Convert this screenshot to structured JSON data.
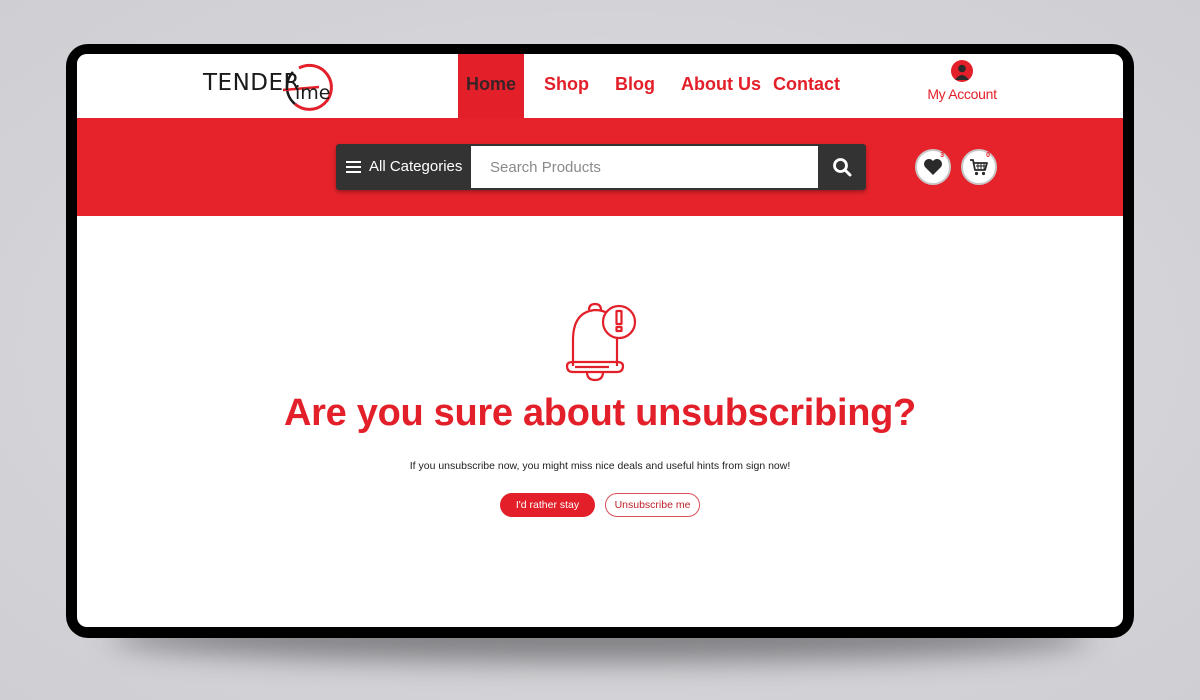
{
  "brand": {
    "logo_word1": "TENDER",
    "logo_word2": "ime",
    "accent_color": "#e3202a",
    "dark_color": "#333333"
  },
  "nav": {
    "items": [
      {
        "label": "Home",
        "active": true
      },
      {
        "label": "Shop",
        "active": false
      },
      {
        "label": "Blog",
        "active": false
      },
      {
        "label": "About Us",
        "active": false
      },
      {
        "label": "Contact",
        "active": false
      }
    ]
  },
  "account": {
    "icon": "user-icon",
    "label": "My Account"
  },
  "search": {
    "categories_label": "All Categories",
    "categories_icon": "menu-icon",
    "placeholder": "Search Products",
    "value": "",
    "button_icon": "search-icon"
  },
  "actions": {
    "wishlist": {
      "icon": "heart-icon",
      "count": "3"
    },
    "cart": {
      "icon": "cart-icon",
      "count": "0"
    }
  },
  "main": {
    "icon": "bell-alert-icon",
    "heading": "Are you sure about unsubscribing?",
    "message": "If you unsubscribe now, you might miss nice deals and useful hints from sign now!",
    "stay_button": "I'd rather stay",
    "unsubscribe_button": "Unsubscribe me"
  }
}
